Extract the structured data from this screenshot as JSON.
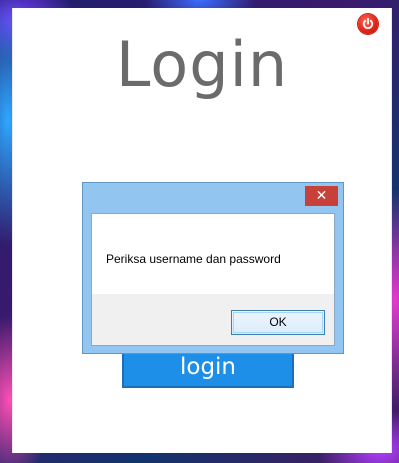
{
  "window": {
    "title": "Login",
    "power_icon": "power-icon"
  },
  "form": {
    "login_button_label": "login"
  },
  "dialog": {
    "close_label": "✕",
    "message": "Periksa username dan password",
    "ok_label": "OK"
  },
  "colors": {
    "login_button": "#1e8fe8",
    "power_button": "#e3261a",
    "dialog_frame": "#92c5ef",
    "dialog_close": "#c7403a"
  }
}
